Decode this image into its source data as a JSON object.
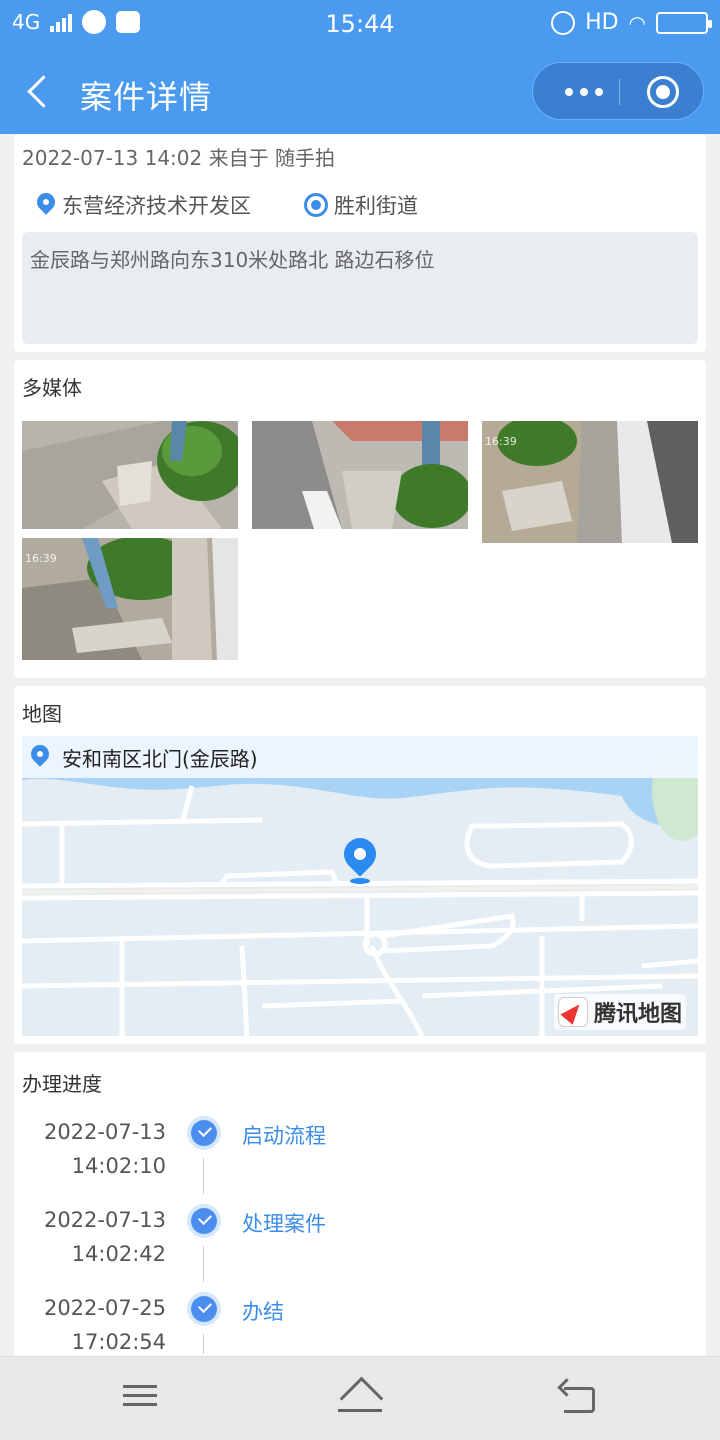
{
  "status_bar": {
    "network": "4G",
    "time": "15:44",
    "hd": "HD"
  },
  "header": {
    "title": "案件详情"
  },
  "case": {
    "meta": "2022-07-13 14:02 来自于 随手拍",
    "district": "东营经济技术开发区",
    "street": "胜利街道",
    "description": "金辰路与郑州路向东310米处路北 路边石移位"
  },
  "media": {
    "title": "多媒体",
    "photo_timestamp": "16:39"
  },
  "map": {
    "title": "地图",
    "address": "安和南区北门(金辰路)",
    "provider": "腾讯地图"
  },
  "progress": {
    "title": "办理进度",
    "steps": [
      {
        "date": "2022-07-13",
        "time": "14:02:10",
        "label": "启动流程"
      },
      {
        "date": "2022-07-13",
        "time": "14:02:42",
        "label": "处理案件"
      },
      {
        "date": "2022-07-25",
        "time": "17:02:54",
        "label": "办结"
      }
    ]
  }
}
